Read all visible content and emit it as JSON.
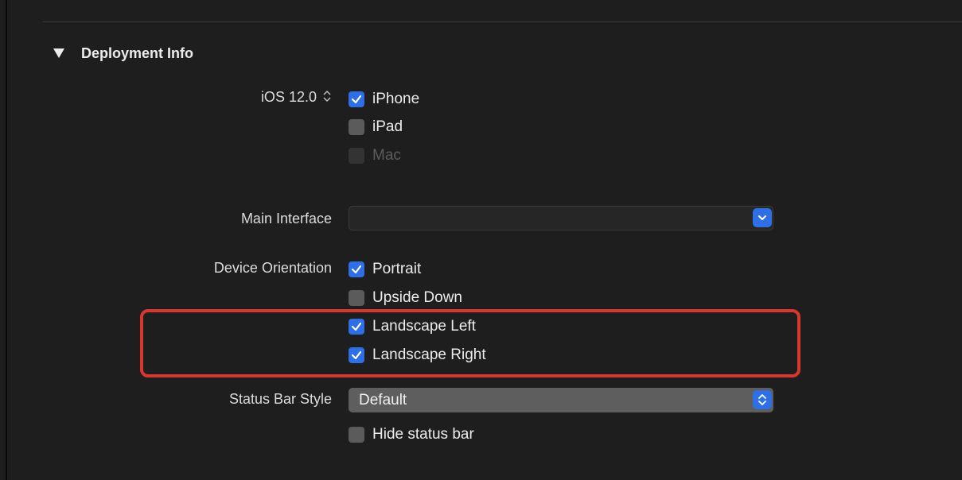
{
  "section": {
    "title": "Deployment Info"
  },
  "deployment_target": {
    "label": "iOS 12.0",
    "devices": [
      {
        "label": "iPhone",
        "checked": true,
        "enabled": true
      },
      {
        "label": "iPad",
        "checked": false,
        "enabled": true
      },
      {
        "label": "Mac",
        "checked": false,
        "enabled": false
      }
    ]
  },
  "main_interface": {
    "label": "Main Interface",
    "value": ""
  },
  "device_orientation": {
    "label": "Device Orientation",
    "options": [
      {
        "label": "Portrait",
        "checked": true
      },
      {
        "label": "Upside Down",
        "checked": false
      },
      {
        "label": "Landscape Left",
        "checked": true
      },
      {
        "label": "Landscape Right",
        "checked": true
      }
    ]
  },
  "status_bar": {
    "label": "Status Bar Style",
    "value": "Default",
    "hide_label": "Hide status bar",
    "hide_checked": false
  },
  "colors": {
    "accent": "#2f6fe6",
    "highlight": "#d9372e",
    "background": "#1e1e1e"
  }
}
